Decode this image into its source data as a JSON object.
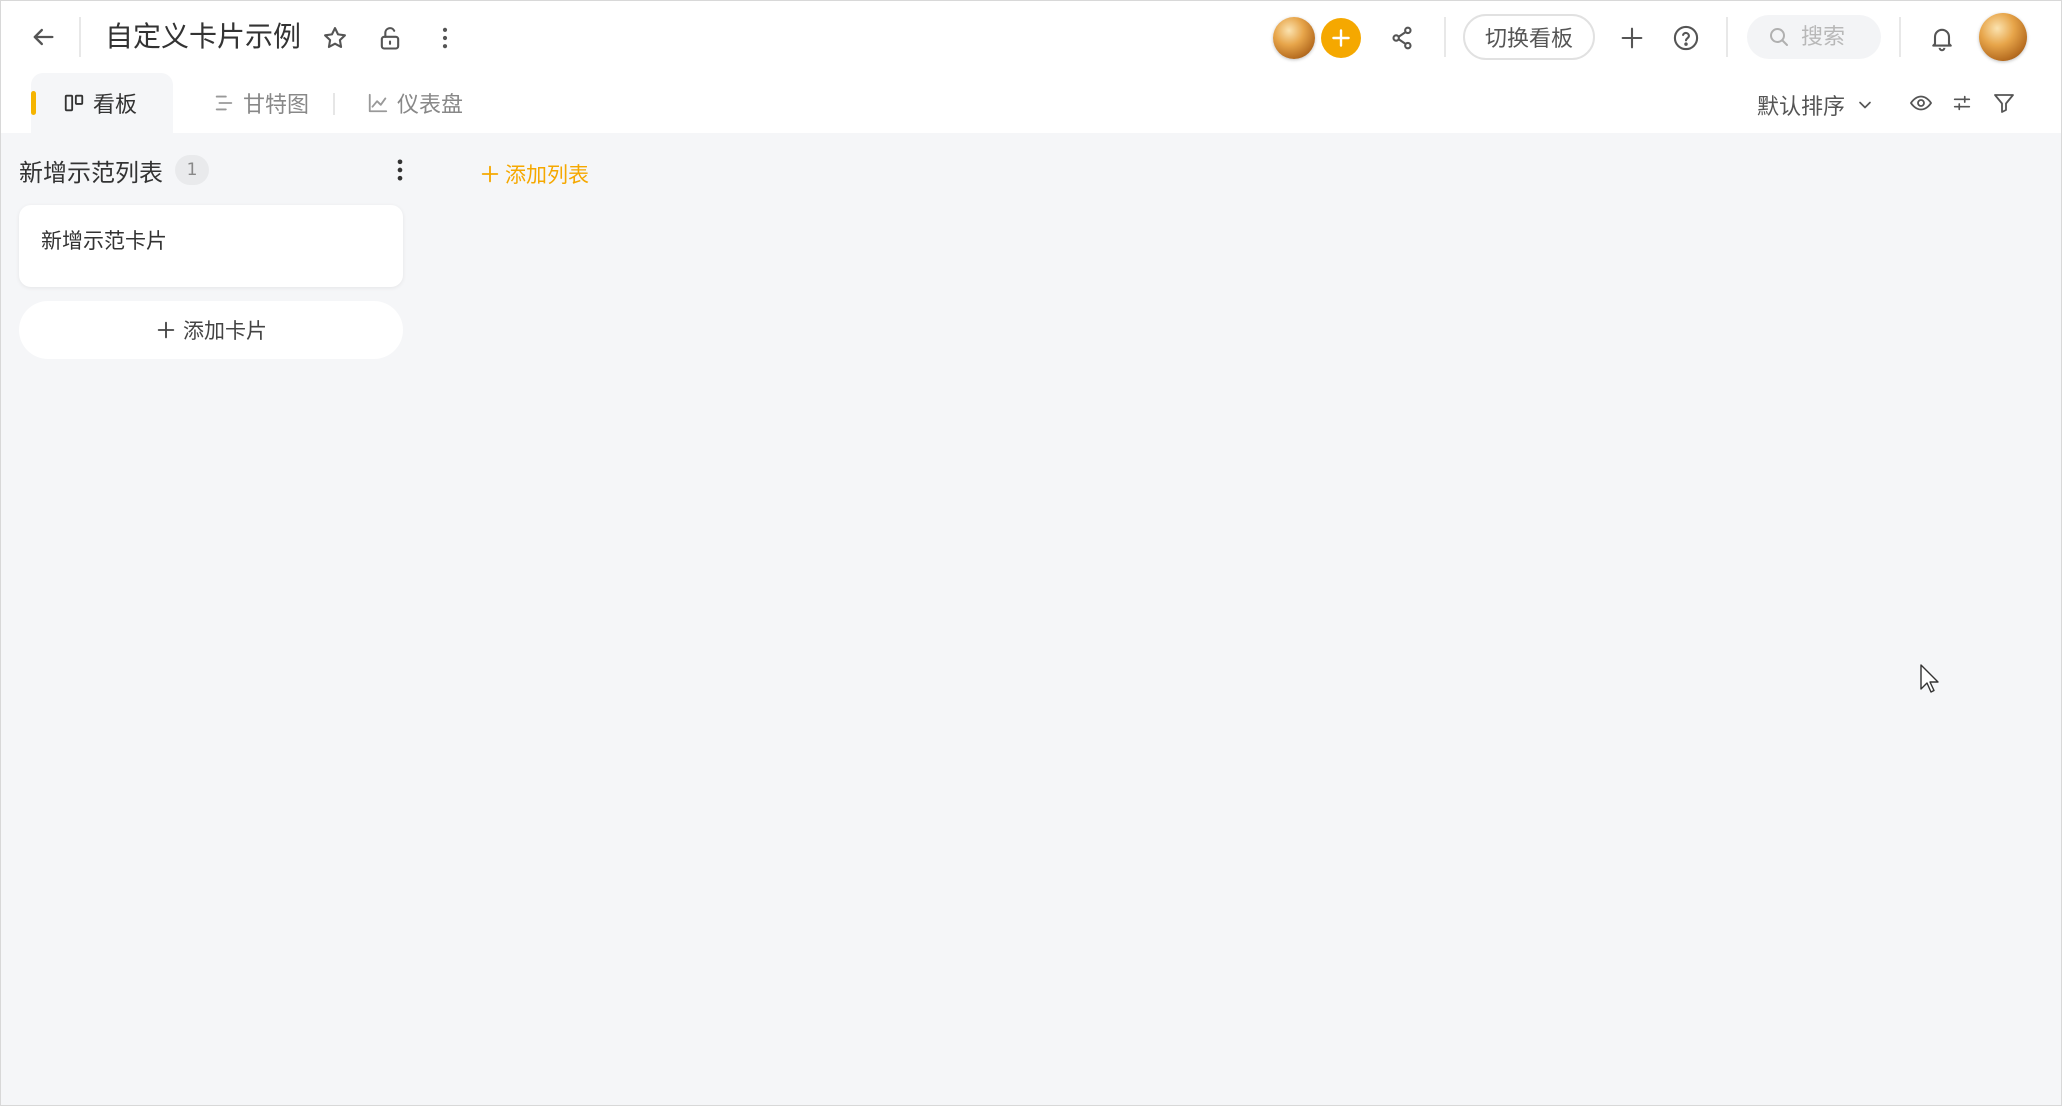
{
  "header": {
    "title": "自定义卡片示例",
    "switch_board_label": "切换看板",
    "search_placeholder": "搜索",
    "icons": {
      "back": "arrow-left-icon",
      "star": "star-icon",
      "lock": "unlock-icon",
      "more": "more-vertical-icon",
      "add_member": "plus-icon",
      "share": "share-icon",
      "add": "plus-icon",
      "help": "help-circle-icon",
      "search": "search-icon",
      "notification": "bell-icon"
    }
  },
  "view_tabs": {
    "tabs": [
      {
        "label": "看板",
        "icon": "kanban-icon",
        "active": true
      },
      {
        "label": "甘特图",
        "icon": "gantt-icon",
        "active": false
      },
      {
        "label": "仪表盘",
        "icon": "line-chart-icon",
        "active": false
      }
    ],
    "sort_label": "默认排序",
    "tools": [
      "eye-icon",
      "adjust-icon",
      "filter-icon"
    ]
  },
  "board": {
    "lists": [
      {
        "title": "新增示范列表",
        "count": "1",
        "cards": [
          {
            "title": "新增示范卡片"
          }
        ],
        "add_card_label": "添加卡片"
      }
    ],
    "add_list_label": "添加列表"
  },
  "colors": {
    "accent": "#f5a800",
    "board_background": "#f5f6f8",
    "header_background": "#ffffff"
  }
}
